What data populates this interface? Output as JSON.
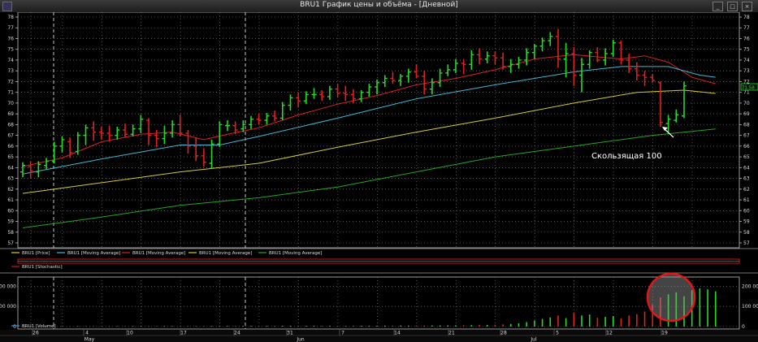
{
  "window": {
    "title": "BRU1 График цены и объёма - [Дневной]",
    "buttons": [
      "_",
      "□",
      "×"
    ]
  },
  "legends": {
    "main": [
      "BRU1 [Price]",
      "BRU1 [Moving Average]",
      "BRU1 [Moving Average]",
      "BRU1 [Moving Average]",
      "BRU1 [Moving Average]"
    ],
    "stochastic": "BRU1 [Stochastic]",
    "volume": "BRU1 [Volume]"
  },
  "annotation": "Скользящая 100",
  "last_price_label": "71.58",
  "colors": {
    "up": "#22dd22",
    "down": "#e02020",
    "ma_red": "#dd2020",
    "ma_cyan": "#3fb8d8",
    "ma_yellow": "#d8cc30",
    "ma_green": "#22a822",
    "grid": "#8a8a8a",
    "stoch_band": "#c81818"
  },
  "chart_data": [
    {
      "type": "ohlc",
      "title": "BRU1 [Price]",
      "ylim": [
        57,
        78
      ],
      "y_ticks": [
        57,
        58,
        59,
        60,
        61,
        62,
        63,
        64,
        65,
        66,
        67,
        68,
        69,
        70,
        71,
        72,
        73,
        74,
        75,
        76,
        77,
        78
      ],
      "x_labels": [
        "26",
        "4",
        "10",
        "17",
        "24",
        "31",
        "7",
        "14",
        "21",
        "28",
        "5",
        "12",
        "19"
      ],
      "months": [
        "May",
        "Jun",
        "Jul"
      ],
      "bars": [
        {
          "o": 63.6,
          "h": 64.5,
          "l": 63.1,
          "c": 64.2
        },
        {
          "o": 64.1,
          "h": 64.6,
          "l": 63.0,
          "c": 63.7
        },
        {
          "o": 63.6,
          "h": 64.6,
          "l": 63.1,
          "c": 64.3
        },
        {
          "o": 64.2,
          "h": 64.9,
          "l": 63.8,
          "c": 64.6
        },
        {
          "o": 64.6,
          "h": 66.4,
          "l": 64.4,
          "c": 66.0
        },
        {
          "o": 66.0,
          "h": 66.9,
          "l": 65.4,
          "c": 66.6
        },
        {
          "o": 66.4,
          "h": 66.8,
          "l": 64.9,
          "c": 65.4
        },
        {
          "o": 65.5,
          "h": 67.3,
          "l": 65.2,
          "c": 67.0
        },
        {
          "o": 67.0,
          "h": 68.0,
          "l": 66.1,
          "c": 67.7
        },
        {
          "o": 67.7,
          "h": 68.3,
          "l": 66.5,
          "c": 67.3
        },
        {
          "o": 67.3,
          "h": 67.8,
          "l": 66.6,
          "c": 67.2
        },
        {
          "o": 67.2,
          "h": 67.9,
          "l": 66.4,
          "c": 67.0
        },
        {
          "o": 67.0,
          "h": 67.8,
          "l": 66.6,
          "c": 67.5
        },
        {
          "o": 67.5,
          "h": 68.1,
          "l": 66.8,
          "c": 67.1
        },
        {
          "o": 67.1,
          "h": 68.0,
          "l": 66.9,
          "c": 67.6
        },
        {
          "o": 67.6,
          "h": 68.9,
          "l": 67.2,
          "c": 68.5
        },
        {
          "o": 68.4,
          "h": 68.6,
          "l": 66.1,
          "c": 67.0
        },
        {
          "o": 67.0,
          "h": 67.5,
          "l": 65.9,
          "c": 66.7
        },
        {
          "o": 66.7,
          "h": 67.9,
          "l": 66.2,
          "c": 67.2
        },
        {
          "o": 67.2,
          "h": 68.4,
          "l": 66.8,
          "c": 68.0
        },
        {
          "o": 68.0,
          "h": 68.9,
          "l": 66.9,
          "c": 67.2
        },
        {
          "o": 67.2,
          "h": 67.5,
          "l": 65.3,
          "c": 66.0
        },
        {
          "o": 66.0,
          "h": 66.8,
          "l": 64.6,
          "c": 65.1
        },
        {
          "o": 65.1,
          "h": 65.8,
          "l": 64.1,
          "c": 64.5
        },
        {
          "o": 64.4,
          "h": 66.6,
          "l": 63.9,
          "c": 66.2
        },
        {
          "o": 66.2,
          "h": 68.3,
          "l": 65.9,
          "c": 68.0
        },
        {
          "o": 67.9,
          "h": 68.4,
          "l": 67.4,
          "c": 67.9
        },
        {
          "o": 67.9,
          "h": 68.3,
          "l": 67.1,
          "c": 67.5
        },
        {
          "o": 67.6,
          "h": 68.4,
          "l": 67.3,
          "c": 68.0
        },
        {
          "o": 68.0,
          "h": 68.8,
          "l": 67.6,
          "c": 68.5
        },
        {
          "o": 68.5,
          "h": 69.0,
          "l": 68.0,
          "c": 68.4
        },
        {
          "o": 68.4,
          "h": 69.1,
          "l": 68.0,
          "c": 68.8
        },
        {
          "o": 68.8,
          "h": 69.3,
          "l": 68.3,
          "c": 68.6
        },
        {
          "o": 68.6,
          "h": 70.1,
          "l": 68.4,
          "c": 69.8
        },
        {
          "o": 69.8,
          "h": 70.8,
          "l": 69.3,
          "c": 70.5
        },
        {
          "o": 70.5,
          "h": 71.0,
          "l": 69.6,
          "c": 70.2
        },
        {
          "o": 70.2,
          "h": 71.1,
          "l": 69.9,
          "c": 70.8
        },
        {
          "o": 70.8,
          "h": 71.4,
          "l": 70.4,
          "c": 70.8
        },
        {
          "o": 70.8,
          "h": 71.2,
          "l": 70.2,
          "c": 70.6
        },
        {
          "o": 70.6,
          "h": 71.6,
          "l": 70.3,
          "c": 71.3
        },
        {
          "o": 71.3,
          "h": 71.8,
          "l": 70.5,
          "c": 70.9
        },
        {
          "o": 70.9,
          "h": 71.6,
          "l": 70.2,
          "c": 70.8
        },
        {
          "o": 70.8,
          "h": 71.3,
          "l": 70.0,
          "c": 70.4
        },
        {
          "o": 70.4,
          "h": 71.2,
          "l": 70.1,
          "c": 71.0
        },
        {
          "o": 71.0,
          "h": 71.8,
          "l": 70.6,
          "c": 71.5
        },
        {
          "o": 71.5,
          "h": 72.2,
          "l": 70.8,
          "c": 71.9
        },
        {
          "o": 71.9,
          "h": 72.6,
          "l": 71.5,
          "c": 72.3
        },
        {
          "o": 72.3,
          "h": 72.9,
          "l": 71.8,
          "c": 72.1
        },
        {
          "o": 72.1,
          "h": 72.7,
          "l": 71.6,
          "c": 72.5
        },
        {
          "o": 72.5,
          "h": 73.2,
          "l": 71.9,
          "c": 72.9
        },
        {
          "o": 72.9,
          "h": 73.6,
          "l": 72.3,
          "c": 72.5
        },
        {
          "o": 72.5,
          "h": 73.0,
          "l": 70.8,
          "c": 71.3
        },
        {
          "o": 71.3,
          "h": 72.3,
          "l": 70.8,
          "c": 71.9
        },
        {
          "o": 71.9,
          "h": 73.2,
          "l": 71.5,
          "c": 72.8
        },
        {
          "o": 72.8,
          "h": 73.6,
          "l": 72.5,
          "c": 73.1
        },
        {
          "o": 73.1,
          "h": 74.1,
          "l": 72.8,
          "c": 73.7
        },
        {
          "o": 73.7,
          "h": 74.1,
          "l": 72.7,
          "c": 73.6
        },
        {
          "o": 73.6,
          "h": 74.9,
          "l": 73.1,
          "c": 74.5
        },
        {
          "o": 74.5,
          "h": 75.1,
          "l": 73.6,
          "c": 74.1
        },
        {
          "o": 74.1,
          "h": 74.8,
          "l": 73.7,
          "c": 74.4
        },
        {
          "o": 74.4,
          "h": 74.8,
          "l": 73.6,
          "c": 74.2
        },
        {
          "o": 74.2,
          "h": 74.7,
          "l": 73.1,
          "c": 73.4
        },
        {
          "o": 73.4,
          "h": 74.1,
          "l": 72.8,
          "c": 73.6
        },
        {
          "o": 73.6,
          "h": 74.3,
          "l": 73.2,
          "c": 74.0
        },
        {
          "o": 74.0,
          "h": 75.1,
          "l": 73.5,
          "c": 74.7
        },
        {
          "o": 74.7,
          "h": 75.5,
          "l": 74.1,
          "c": 75.3
        },
        {
          "o": 75.3,
          "h": 76.1,
          "l": 74.8,
          "c": 75.8
        },
        {
          "o": 75.8,
          "h": 76.6,
          "l": 75.3,
          "c": 76.2
        },
        {
          "o": 76.2,
          "h": 76.9,
          "l": 73.3,
          "c": 74.1
        },
        {
          "o": 74.1,
          "h": 75.6,
          "l": 72.4,
          "c": 74.6
        },
        {
          "o": 74.6,
          "h": 75.2,
          "l": 71.6,
          "c": 72.6
        },
        {
          "o": 72.6,
          "h": 74.2,
          "l": 71.0,
          "c": 73.6
        },
        {
          "o": 73.6,
          "h": 74.9,
          "l": 73.2,
          "c": 74.7
        },
        {
          "o": 74.7,
          "h": 75.2,
          "l": 73.8,
          "c": 74.0
        },
        {
          "o": 74.0,
          "h": 75.1,
          "l": 73.5,
          "c": 74.6
        },
        {
          "o": 74.6,
          "h": 75.9,
          "l": 74.3,
          "c": 75.6
        },
        {
          "o": 75.6,
          "h": 75.8,
          "l": 73.6,
          "c": 74.0
        },
        {
          "o": 74.0,
          "h": 74.6,
          "l": 72.8,
          "c": 73.2
        },
        {
          "o": 73.2,
          "h": 73.8,
          "l": 72.1,
          "c": 72.6
        },
        {
          "o": 72.6,
          "h": 73.0,
          "l": 71.6,
          "c": 72.4
        },
        {
          "o": 72.4,
          "h": 72.7,
          "l": 71.9,
          "c": 72.1
        },
        {
          "o": 71.9,
          "h": 72.0,
          "l": 67.8,
          "c": 68.2
        },
        {
          "o": 68.1,
          "h": 68.9,
          "l": 67.3,
          "c": 68.5
        },
        {
          "o": 68.4,
          "h": 69.4,
          "l": 68.2,
          "c": 68.9
        },
        {
          "o": 68.8,
          "h": 72.0,
          "l": 68.6,
          "c": 71.6
        }
      ],
      "moving_averages": [
        {
          "color": "ma_red",
          "points": [
            [
              0,
              64.1
            ],
            [
              5,
              64.9
            ],
            [
              10,
              66.4
            ],
            [
              15,
              67.1
            ],
            [
              19,
              67.3
            ],
            [
              23,
              66.6
            ],
            [
              26,
              67.1
            ],
            [
              30,
              67.7
            ],
            [
              35,
              68.9
            ],
            [
              40,
              69.9
            ],
            [
              45,
              70.7
            ],
            [
              50,
              71.7
            ],
            [
              55,
              72.3
            ],
            [
              60,
              73.1
            ],
            [
              65,
              74.1
            ],
            [
              70,
              74.5
            ],
            [
              73,
              74.3
            ],
            [
              76,
              74.1
            ],
            [
              79,
              74.4
            ],
            [
              82,
              73.8
            ],
            [
              85,
              72.4
            ],
            [
              88,
              71.8
            ]
          ]
        },
        {
          "color": "ma_cyan",
          "points": [
            [
              0,
              63.4
            ],
            [
              10,
              64.8
            ],
            [
              20,
              66.1
            ],
            [
              25,
              66.1
            ],
            [
              30,
              66.9
            ],
            [
              40,
              68.6
            ],
            [
              50,
              70.4
            ],
            [
              60,
              71.7
            ],
            [
              70,
              72.9
            ],
            [
              76,
              73.4
            ],
            [
              82,
              73.4
            ],
            [
              86,
              72.6
            ],
            [
              88,
              72.4
            ]
          ]
        },
        {
          "color": "ma_yellow",
          "points": [
            [
              0,
              61.6
            ],
            [
              10,
              62.6
            ],
            [
              20,
              63.6
            ],
            [
              30,
              64.4
            ],
            [
              40,
              65.9
            ],
            [
              50,
              67.3
            ],
            [
              60,
              68.6
            ],
            [
              70,
              70.0
            ],
            [
              78,
              71.0
            ],
            [
              84,
              71.2
            ],
            [
              88,
              70.9
            ]
          ]
        },
        {
          "color": "ma_green",
          "points": [
            [
              0,
              58.4
            ],
            [
              10,
              59.4
            ],
            [
              20,
              60.5
            ],
            [
              30,
              61.2
            ],
            [
              40,
              62.2
            ],
            [
              50,
              63.6
            ],
            [
              60,
              65.0
            ],
            [
              70,
              66.0
            ],
            [
              80,
              67.0
            ],
            [
              88,
              67.6
            ]
          ]
        }
      ]
    },
    {
      "type": "bar",
      "title": "BRU1 [Volume]",
      "y_ticks": [
        0,
        100000,
        200000
      ],
      "y_tick_labels": [
        "0",
        "100 000",
        "200 000"
      ],
      "ylim": [
        0,
        230000
      ],
      "values": [
        1500,
        1800,
        1600,
        2000,
        1700,
        2100,
        1900,
        2200,
        2000,
        2300,
        2100,
        2400,
        2200,
        2300,
        2500,
        2400,
        2600,
        2500,
        2700,
        2600,
        2800,
        2700,
        3000,
        2900,
        3100,
        3000,
        3200,
        3100,
        3300,
        3200,
        3500,
        3400,
        3600,
        3500,
        3700,
        3600,
        3800,
        3700,
        4000,
        3900,
        4100,
        4000,
        4300,
        4200,
        4500,
        4400,
        4700,
        4600,
        5000,
        4900,
        5300,
        5200,
        5600,
        5500,
        6000,
        6200,
        6800,
        7200,
        8000,
        8500,
        9500,
        11000,
        13000,
        16000,
        22000,
        30000,
        38000,
        45000,
        55000,
        42000,
        70000,
        55000,
        60000,
        44000,
        48000,
        52000,
        40000,
        55000,
        62000,
        75000,
        110000,
        145000,
        160000,
        170000,
        150000,
        180000,
        190000,
        185000,
        175000
      ]
    },
    {
      "type": "line",
      "title": "BRU1 [Stochastic]",
      "values": []
    }
  ]
}
